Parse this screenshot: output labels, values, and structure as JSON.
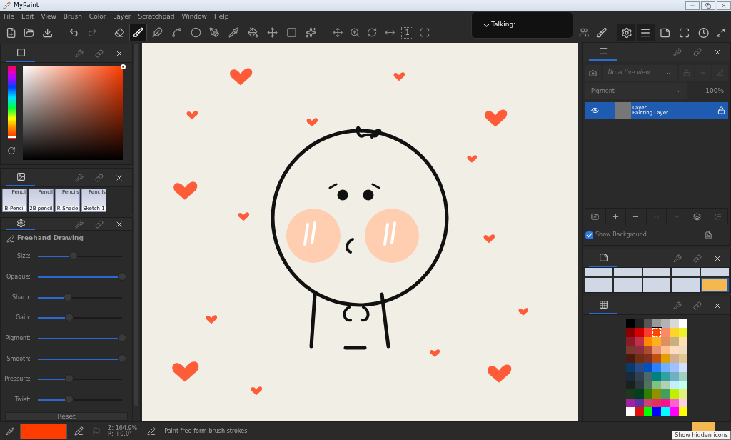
{
  "window": {
    "title": "MyPaint"
  },
  "menu": [
    "File",
    "Edit",
    "View",
    "Brush",
    "Color",
    "Layer",
    "Scratchpad",
    "Window",
    "Help"
  ],
  "toolbar": {
    "tools": [
      {
        "selected": true
      },
      {
        "selected": false
      },
      {
        "selected": false
      },
      {
        "selected": false
      },
      {
        "selected": false
      },
      {
        "selected": false
      },
      {
        "selected": false
      },
      {
        "selected": false
      },
      {
        "selected": false
      },
      {
        "selected": false
      }
    ],
    "reset_zoom_label": "1"
  },
  "notification": {
    "text": "Talking:"
  },
  "color_panel": {
    "hue": {
      "level": 0.03
    }
  },
  "brush_presets": [
    {
      "group": "Pencil",
      "name": "B-Pencil"
    },
    {
      "group": "Pencil",
      "name": "2B pencil"
    },
    {
      "group": "Pencils",
      "name": "P. Shade"
    },
    {
      "group": "Pencils",
      "name": "Sketch 1"
    }
  ],
  "brush_settings": {
    "title": "Freehand Drawing",
    "sliders": [
      {
        "label": "Size:",
        "level": 0.42
      },
      {
        "label": "Opaque:",
        "level": 1
      },
      {
        "label": "Sharp:",
        "level": 0.36
      },
      {
        "label": "Gain:",
        "level": 0.37
      },
      {
        "label": "Pigment:",
        "level": 1
      },
      {
        "label": "Smooth:",
        "level": 1
      },
      {
        "label": "Pressure:",
        "level": 0.37
      },
      {
        "label": "Twist:",
        "level": 0.37
      }
    ],
    "reset": "Reset"
  },
  "layers": {
    "view": "No active view",
    "mode": "Pigment",
    "opacity": "100%",
    "items": [
      {
        "name": "Layer",
        "type": "Painting Layer",
        "visible": true,
        "locked": false,
        "selected": true
      }
    ],
    "show_background": {
      "label": "Show Background",
      "checked": true
    }
  },
  "brush_thumbnails": [
    {
      "selected": false
    },
    {
      "selected": false
    },
    {
      "selected": false
    },
    {
      "selected": false
    },
    {
      "selected": false
    },
    {
      "selected": false
    },
    {
      "selected": false
    },
    {
      "selected": false
    },
    {
      "selected": false
    },
    {
      "selected": true
    }
  ],
  "palette": [
    {
      "color": "#000000",
      "selected": false
    },
    {
      "color": "#222222",
      "selected": false
    },
    {
      "color": "#555555",
      "selected": false
    },
    {
      "color": "#999999",
      "selected": false
    },
    {
      "color": "#b3b3b3",
      "selected": false
    },
    {
      "color": "#d9d9d9",
      "selected": false
    },
    {
      "color": "#ffffff",
      "selected": false
    },
    {
      "color": "#8b0000",
      "selected": false
    },
    {
      "color": "#d40000",
      "selected": false
    },
    {
      "color": "#ff3b2f",
      "selected": false
    },
    {
      "color": "#ff4500",
      "selected": true
    },
    {
      "color": "#f98a6a",
      "selected": false
    },
    {
      "color": "#ffd42a",
      "selected": false
    },
    {
      "color": "#eef12a",
      "selected": false
    },
    {
      "color": "#8b1a2b",
      "selected": false
    },
    {
      "color": "#c0304a",
      "selected": false
    },
    {
      "color": "#ff8c00",
      "selected": false
    },
    {
      "color": "#ffb020",
      "selected": false
    },
    {
      "color": "#e09060",
      "selected": false
    },
    {
      "color": "#c8b080",
      "selected": false
    },
    {
      "color": "#ffe0b0",
      "selected": false
    },
    {
      "color": "#7a3a2a",
      "selected": false
    },
    {
      "color": "#8b3040",
      "selected": false
    },
    {
      "color": "#b04a30",
      "selected": false
    },
    {
      "color": "#e89070",
      "selected": false
    },
    {
      "color": "#ffc090",
      "selected": false
    },
    {
      "color": "#ffdcc0",
      "selected": false
    },
    {
      "color": "#f0dcc0",
      "selected": false
    },
    {
      "color": "#4a1a10",
      "selected": false
    },
    {
      "color": "#703010",
      "selected": false
    },
    {
      "color": "#803020",
      "selected": false
    },
    {
      "color": "#c05010",
      "selected": false
    },
    {
      "color": "#e0a000",
      "selected": false
    },
    {
      "color": "#d0b090",
      "selected": false
    },
    {
      "color": "#e0c890",
      "selected": false
    },
    {
      "color": "#0a3a6a",
      "selected": false
    },
    {
      "color": "#2a4a8a",
      "selected": false
    },
    {
      "color": "#0050c0",
      "selected": false
    },
    {
      "color": "#2a80ff",
      "selected": false
    },
    {
      "color": "#70b0ff",
      "selected": false
    },
    {
      "color": "#a0c0ff",
      "selected": false
    },
    {
      "color": "#d0e0ff",
      "selected": false
    },
    {
      "color": "#1a2a3a",
      "selected": false
    },
    {
      "color": "#304050",
      "selected": false
    },
    {
      "color": "#4a6a6a",
      "selected": false
    },
    {
      "color": "#008080",
      "selected": false
    },
    {
      "color": "#30a0a0",
      "selected": false
    },
    {
      "color": "#70b0c0",
      "selected": false
    },
    {
      "color": "#a0d0c0",
      "selected": false
    },
    {
      "color": "#1a2020",
      "selected": false
    },
    {
      "color": "#2a3a3a",
      "selected": false
    },
    {
      "color": "#507060",
      "selected": false
    },
    {
      "color": "#80c080",
      "selected": false
    },
    {
      "color": "#b0d0b0",
      "selected": false
    },
    {
      "color": "#c0f0ff",
      "selected": false
    },
    {
      "color": "#c0fff0",
      "selected": false
    },
    {
      "color": "#1a3a1a",
      "selected": false
    },
    {
      "color": "#004020",
      "selected": false
    },
    {
      "color": "#308000",
      "selected": false
    },
    {
      "color": "#909000",
      "selected": false
    },
    {
      "color": "#40a060",
      "selected": false
    },
    {
      "color": "#c0f000",
      "selected": false
    },
    {
      "color": "#e0f080",
      "selected": false
    },
    {
      "color": "#a020a0",
      "selected": false
    },
    {
      "color": "#6030a0",
      "selected": false
    },
    {
      "color": "#d04070",
      "selected": false
    },
    {
      "color": "#e03060",
      "selected": false
    },
    {
      "color": "#ff1090",
      "selected": false
    },
    {
      "color": "#ff60d0",
      "selected": false
    },
    {
      "color": "#ffd0e0",
      "selected": false
    },
    {
      "color": "#fefefe",
      "selected": false
    },
    {
      "color": "#e01010",
      "selected": false
    },
    {
      "color": "#00ff00",
      "selected": false
    },
    {
      "color": "#0000ff",
      "selected": false
    },
    {
      "color": "#00ffff",
      "selected": false
    },
    {
      "color": "#ff00ff",
      "selected": false
    },
    {
      "color": "#ffff00",
      "selected": false
    }
  ],
  "status_bar": {
    "zoom": "Z: 164.9%",
    "rotation": "R: +0.0°",
    "message": "Paint free-form brush strokes"
  },
  "tooltip": "Show hidden icons"
}
